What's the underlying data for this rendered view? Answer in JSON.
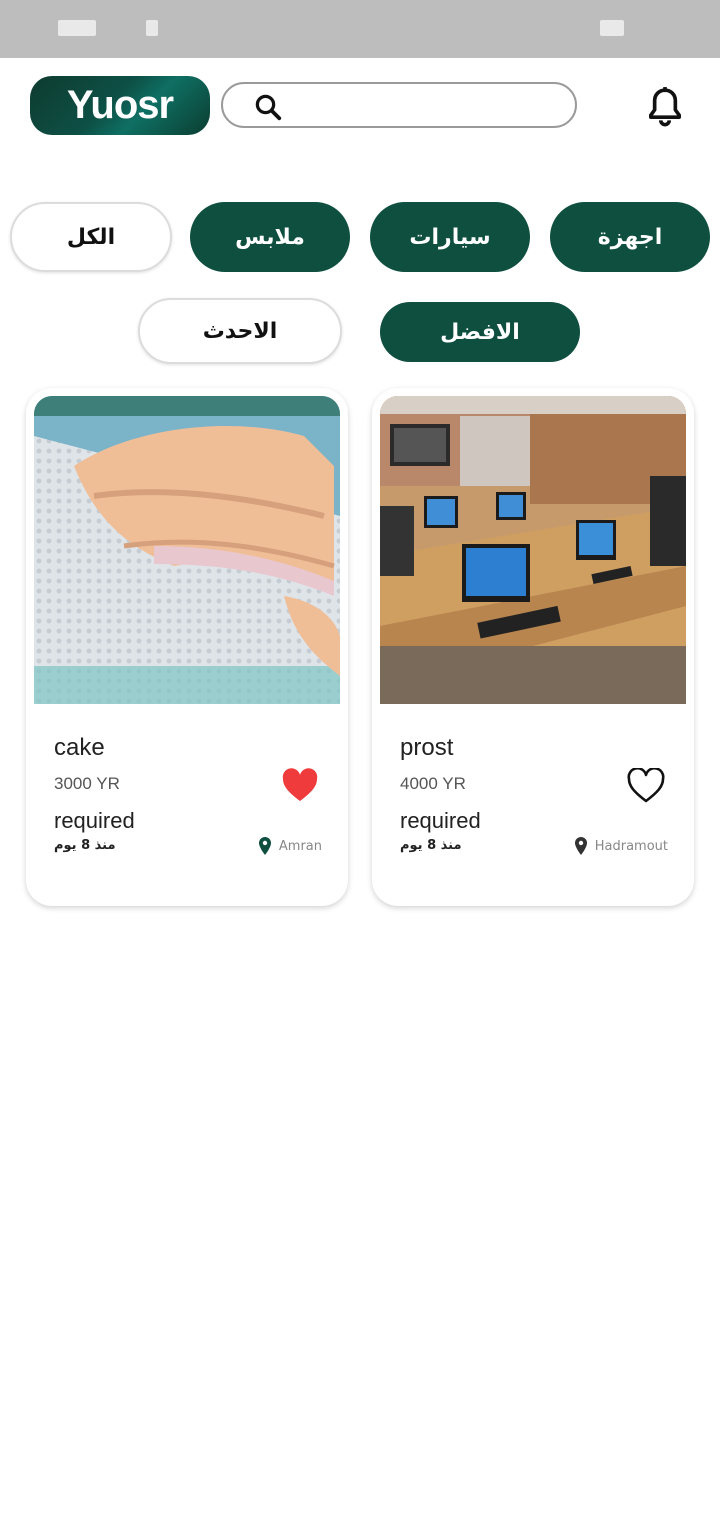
{
  "status_bar": {
    "left_text": "",
    "right_text": ""
  },
  "header": {
    "logo_text": "Yuosr",
    "search_placeholder": ""
  },
  "categories": [
    "اجهزة",
    "سيارات",
    "ملابس",
    "الكل"
  ],
  "sort": {
    "best": "الافضل",
    "newest": "الاحدث"
  },
  "products": [
    {
      "title": "prost",
      "price": "4000 YR",
      "status": "required",
      "age": "منذ 8 يوم",
      "location": "Hadramout",
      "favorite": false,
      "image": "computer-lab-photo"
    },
    {
      "title": "cake",
      "price": "3000 YR",
      "status": "required",
      "age": "منذ 8 يوم",
      "location": "Amran",
      "favorite": true,
      "image": "hand-on-knit-fabric-photo"
    }
  ],
  "colors": {
    "primary": "#0f4f3f",
    "favorite": "#ef3b3b"
  }
}
